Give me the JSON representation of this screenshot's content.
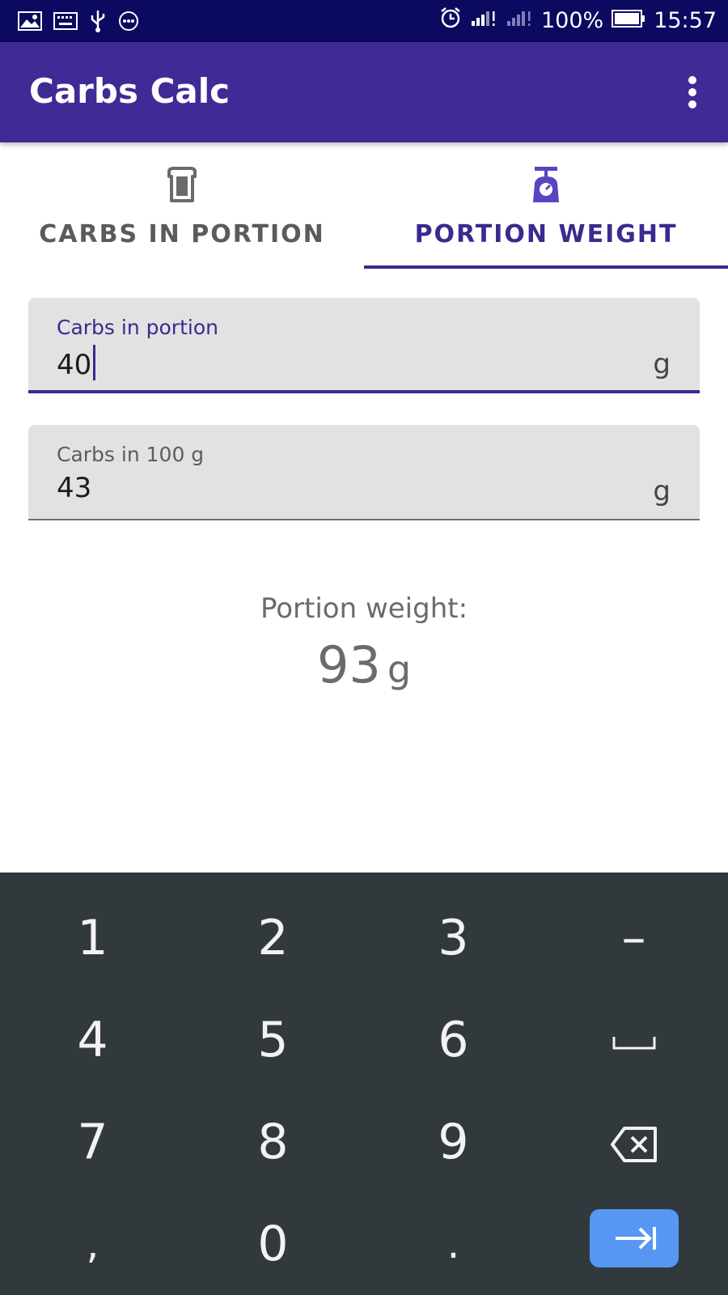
{
  "status_bar": {
    "battery": "100%",
    "time": "15:57"
  },
  "app": {
    "title": "Carbs Calc"
  },
  "tabs": [
    {
      "label": "CARBS IN PORTION",
      "icon": "bread-icon",
      "selected": false
    },
    {
      "label": "PORTION WEIGHT",
      "icon": "scale-icon",
      "selected": true
    }
  ],
  "fields": {
    "carbs_in_portion": {
      "label": "Carbs in portion",
      "value": "40",
      "unit": "g"
    },
    "carbs_in_100g": {
      "label": "Carbs in 100 g",
      "value": "43",
      "unit": "g"
    }
  },
  "result": {
    "label": "Portion weight:",
    "value": "93",
    "unit": "g"
  },
  "keyboard": {
    "keys": [
      "1",
      "2",
      "3",
      "–",
      "4",
      "5",
      "6",
      "␣",
      "7",
      "8",
      "9",
      "⌫",
      ",",
      "0",
      ".",
      "→|"
    ]
  },
  "colors": {
    "primary": "#3f2a96",
    "status_bar": "#0b0a60",
    "accent": "#3b2a8f",
    "keyboard_bg": "#32393c",
    "enter_key": "#5797f4"
  }
}
